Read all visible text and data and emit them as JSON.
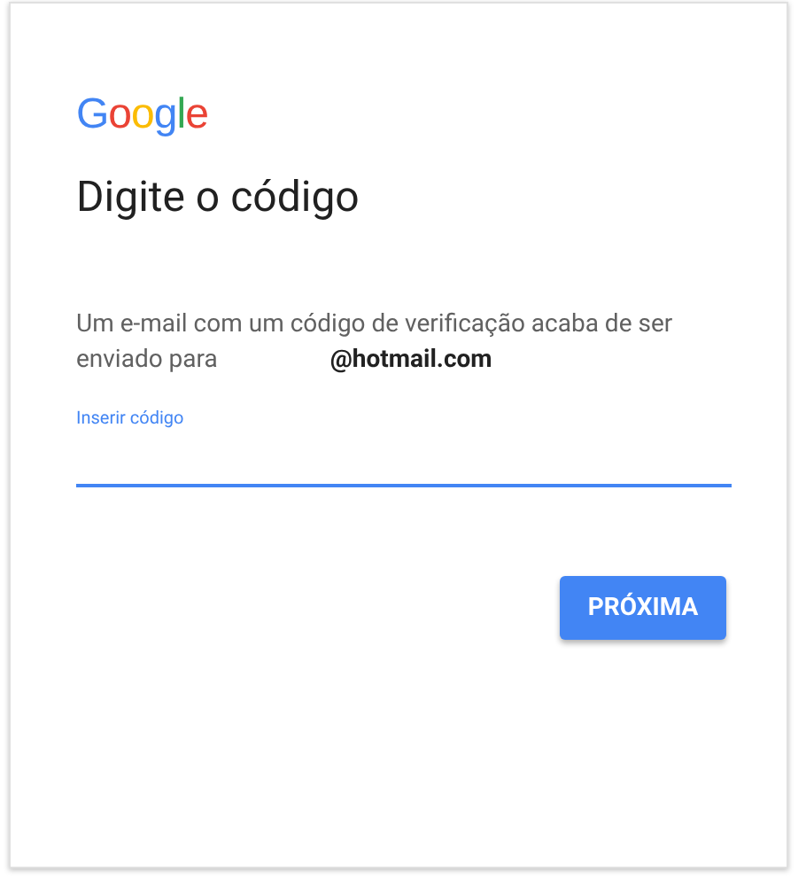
{
  "logo": "Google",
  "title": "Digite o código",
  "message": "Um e-mail com um código de verificação acaba de ser enviado para",
  "email": "@hotmail.com",
  "code_field": {
    "label": "Inserir código",
    "focused": true
  },
  "next_button": "PRÓXIMA"
}
